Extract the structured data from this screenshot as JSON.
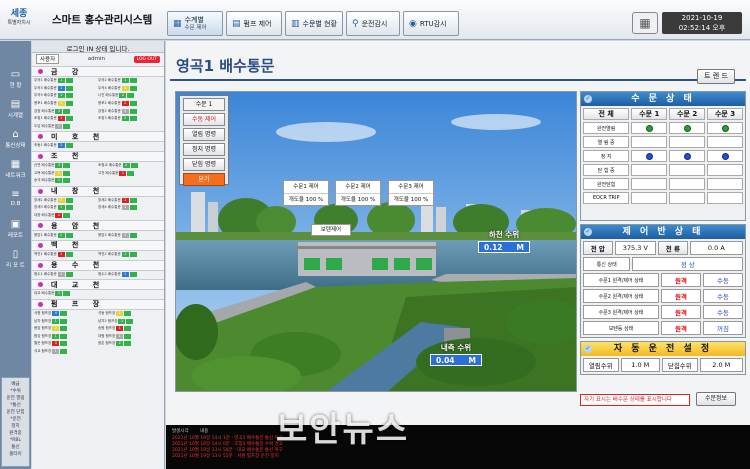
{
  "header": {
    "logo_main": "세종",
    "logo_sub": "특별자치시",
    "system_title": "스마트 홍수관리시스템",
    "buttons": [
      {
        "label": "수계별",
        "sub": "수문 제어"
      },
      {
        "label": "펌프 제어",
        "sub": ""
      },
      {
        "label": "수문별 현황",
        "sub": ""
      },
      {
        "label": "운전감시",
        "sub": ""
      },
      {
        "label": "RTU감시",
        "sub": ""
      }
    ],
    "date": "2021-10-19",
    "time": "02:52:14 오후"
  },
  "nav": [
    {
      "label": "현 황",
      "icon": "monitor-icon"
    },
    {
      "label": "시계열",
      "icon": "chart-icon"
    },
    {
      "label": "통신상태",
      "icon": "network-icon"
    },
    {
      "label": "네트워크",
      "icon": "grid-icon"
    },
    {
      "label": "D.B",
      "icon": "database-icon"
    },
    {
      "label": "레포트",
      "icon": "report-icon"
    },
    {
      "label": "리 포 트",
      "icon": "document-icon"
    }
  ],
  "nav_legend": [
    "배급",
    "*수위",
    "운전 열림",
    "*통신",
    "운전 닫힘",
    "*운전",
    "정지",
    "원격중",
    "*RBL",
    "통신",
    "폴타이"
  ],
  "left": {
    "login_status": "로그인 IN 상태 입니다.",
    "user_label": "사용자",
    "user_name": "admin",
    "logout": "LOG OUT",
    "groups": [
      {
        "name": "금 강",
        "rows": [
          [
            "우곡1 배수통문",
            "1",
            "우곡2 배수통문",
            "1"
          ],
          [
            "우곡3 배수통문",
            "1",
            "우곡4 배수통문",
            "1"
          ],
          [
            "우곡5 배수통문",
            "1",
            "나진 배수통문",
            "2"
          ],
          [
            "용포1 배수통문",
            "2",
            "용포2 배수통문",
            "2"
          ],
          [
            "검정 배수통문",
            "3",
            "강정2 배수통문",
            "2"
          ],
          [
            "조정1 배수통문",
            "1",
            "조정3 배수통문",
            "2"
          ],
          [
            "도담 배수통문",
            "1",
            "",
            ""
          ]
        ]
      },
      {
        "name": "미 호 천",
        "rows": [
          [
            "조동1 배수통문",
            "1",
            "",
            ""
          ]
        ]
      },
      {
        "name": "조 천",
        "rows": [
          [
            "산연 배수통문",
            "3",
            "조정교 배수통문",
            "2"
          ],
          [
            "고복 배수통문",
            "1",
            "고천 배수통문",
            "1"
          ],
          [
            "송석 배수통문",
            "1",
            "",
            ""
          ]
        ]
      },
      {
        "name": "내 창 천",
        "rows": [
          [
            "장세1 배수통문",
            "2",
            "장세2 배수통문",
            "1"
          ],
          [
            "장세3 배수통문",
            "1",
            "장세4 배수통문",
            "1"
          ],
          [
            "내창 배수통문",
            "1",
            "",
            ""
          ]
        ]
      },
      {
        "name": "용 암 천",
        "rows": [
          [
            "용암1 배수통문",
            "2",
            "용암2 배수통문",
            "1"
          ]
        ]
      },
      {
        "name": "백 천",
        "rows": [
          [
            "백천1 배수통문",
            "1",
            "백천2 배수통문",
            "1"
          ]
        ]
      },
      {
        "name": "용 수 천",
        "rows": [
          [
            "용수1 배수통문",
            "1",
            "용수2 배수통문",
            "1"
          ]
        ]
      },
      {
        "name": "대 교 천",
        "rows": [
          [
            "대교 배수통문",
            "1",
            "",
            ""
          ]
        ]
      },
      {
        "name": "펌 프 장",
        "rows": [
          [
            "서원 펌프장",
            "4",
            "석동 펌프장",
            "1"
          ],
          [
            "남차 펌프장",
            "1",
            "남차2 펌프장",
            "1"
          ],
          [
            "봉암 펌프장",
            "2",
            "송원 펌프장",
            "1"
          ],
          [
            "합강 펌프장",
            "1",
            "대평 펌프장",
            "1"
          ],
          [
            "월운 펌프장",
            "3",
            "점촌 펌프장",
            "2"
          ],
          [
            "석교 펌프장",
            "1",
            "",
            ""
          ]
        ]
      }
    ]
  },
  "main": {
    "page_title": "영곡1 배수통문",
    "trend_button": "트 렌 드",
    "commands": [
      "수문 1",
      "수동 제어",
      "열림 명령",
      "정지 명령",
      "닫힘 명령",
      "닫기"
    ],
    "gates": [
      {
        "name": "수문1 제어",
        "open": "개도율 100 %"
      },
      {
        "name": "수문2 제어",
        "open": "개도율 100 %"
      },
      {
        "name": "수문3 제어",
        "open": "개도율 100 %"
      }
    ],
    "opening_ctrl": "보텐제어",
    "outer_level": {
      "label": "하천 수위",
      "value": "0.12",
      "unit": "M"
    },
    "inner_level": {
      "label": "내측 수위",
      "value": "0.04",
      "unit": "M"
    },
    "gate_status": {
      "title": "수 문 상 태",
      "cols": [
        "전 체",
        "수문 1",
        "수문 2",
        "수문 3"
      ],
      "rows": [
        {
          "label": "완전열림",
          "leds": [
            "",
            "green",
            "green",
            "green"
          ]
        },
        {
          "label": "열 림 중",
          "leds": [
            "",
            "",
            "",
            ""
          ]
        },
        {
          "label": "정 지",
          "leds": [
            "",
            "blue",
            "blue",
            "blue"
          ]
        },
        {
          "label": "닫 힘 중",
          "leds": [
            "",
            "",
            "",
            ""
          ]
        },
        {
          "label": "완전닫힘",
          "leds": [
            "",
            "",
            "",
            ""
          ]
        },
        {
          "label": "EOCR TRIP",
          "leds": [
            "",
            "",
            "",
            ""
          ]
        }
      ]
    },
    "control_status": {
      "title": "제 어 반 상 태",
      "voltage_label": "전 압",
      "voltage": "375.3 V",
      "current_label": "전 류",
      "current": "0.0 A",
      "comm_label": "통신 상태",
      "comm_value": "정 상",
      "rows": [
        {
          "label": "수문1 원격/제어 상태",
          "remote": "원격",
          "mode": "수동"
        },
        {
          "label": "수문2 원격/제어 상태",
          "remote": "원격",
          "mode": "수동"
        },
        {
          "label": "수문3 원격/제어 상태",
          "remote": "원격",
          "mode": "수동"
        },
        {
          "label": "보텐등 상태",
          "remote": "원격",
          "mode": "꺼짐"
        }
      ]
    },
    "auto_setting": {
      "title": "자 동 운 전 설 정",
      "open_label": "열림수위",
      "open_value": "1.0 M",
      "close_label": "닫힘수위",
      "close_value": "2.0 M"
    },
    "warning": "자기 표시는 배수문 상태를 표시합니다",
    "pump_info_button": "수문정보",
    "log_header": [
      "발생시각",
      "내용"
    ],
    "log": [
      "2021년 10월 19일 14시 1분 : 영곡1 배수통문 통신 이상",
      "2021년 10월 19일 14시 0분 : 조정1 배수통문 수위 경고",
      "2021년 10월 19일 13시 58분 : 대교 배수통문 통신 복구",
      "2021년 10월 19일 13시 55분 : 서원 펌프장 운전 정지"
    ],
    "watermark": "보안뉴스"
  }
}
